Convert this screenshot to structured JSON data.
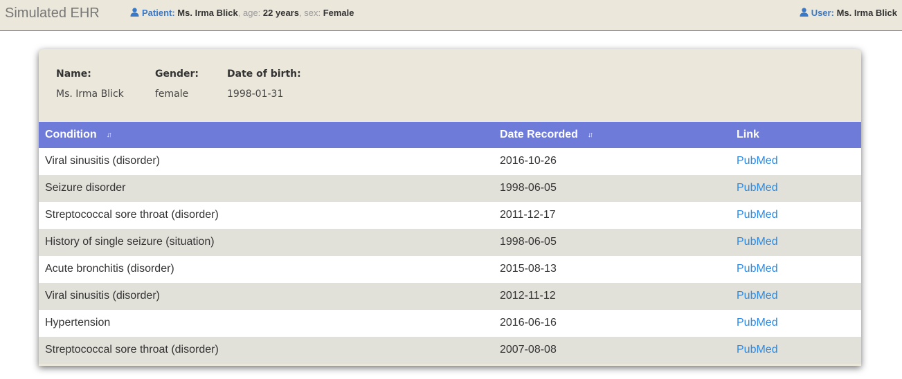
{
  "header": {
    "brand": "Simulated EHR",
    "patient_label": "Patient:",
    "patient_name": "Ms. Irma Blick",
    "age_label": "age:",
    "age_value": "22 years",
    "sex_label": "sex:",
    "sex_value": "Female",
    "user_label": "User:",
    "user_name": "Ms. Irma Blick",
    "sep1": ",",
    "sep2": ","
  },
  "demographics": {
    "name_label": "Name:",
    "name_value": "Ms. Irma Blick",
    "gender_label": "Gender:",
    "gender_value": "female",
    "dob_label": "Date of birth:",
    "dob_value": "1998-01-31"
  },
  "table": {
    "columns": [
      "Condition",
      "Date Recorded",
      "Link"
    ],
    "rows": [
      {
        "condition": "Viral sinusitis (disorder)",
        "date": "2016-10-26",
        "link": "PubMed"
      },
      {
        "condition": "Seizure disorder",
        "date": "1998-06-05",
        "link": "PubMed"
      },
      {
        "condition": "Streptococcal sore throat (disorder)",
        "date": "2011-12-17",
        "link": "PubMed"
      },
      {
        "condition": "History of single seizure (situation)",
        "date": "1998-06-05",
        "link": "PubMed"
      },
      {
        "condition": "Acute bronchitis (disorder)",
        "date": "2015-08-13",
        "link": "PubMed"
      },
      {
        "condition": "Viral sinusitis (disorder)",
        "date": "2012-11-12",
        "link": "PubMed"
      },
      {
        "condition": "Hypertension",
        "date": "2016-06-16",
        "link": "PubMed"
      },
      {
        "condition": "Streptococcal sore throat (disorder)",
        "date": "2007-08-08",
        "link": "PubMed"
      }
    ]
  },
  "colors": {
    "header_bg": "#ebe7db",
    "table_header_bg": "#6f7bd9",
    "row_alt_bg": "#e1e0d9",
    "link": "#2a8ae6",
    "label_blue": "#3a79c7"
  },
  "icons": {
    "patient": "person-icon",
    "user": "person-icon",
    "sort": "sort-icon"
  }
}
